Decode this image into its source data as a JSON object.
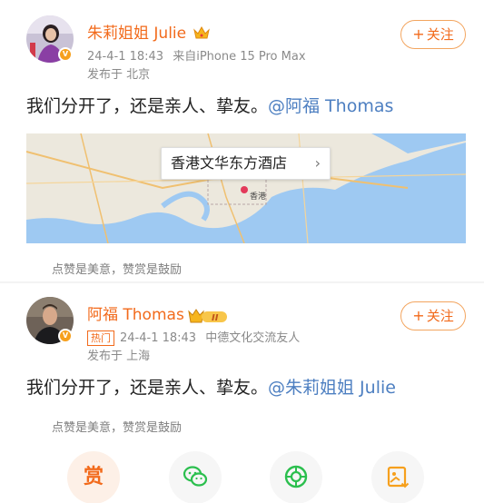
{
  "post1": {
    "username": "朱莉姐姐 Julie",
    "time": "24-4-1 18:43",
    "source": "来自iPhone 15 Pro Max",
    "location": "发布于 北京",
    "follow_label": "关注",
    "content_text": "我们分开了，还是亲人、挚友。",
    "mention": "@阿福 Thomas",
    "map_place": "香港文华东方酒店",
    "map_tag": "香港",
    "like_hint": "点赞是美意，赞赏是鼓励"
  },
  "post2": {
    "username": "阿福 Thomas",
    "badge_level": "II",
    "hot_label": "热门",
    "time": "24-4-1 18:43",
    "source": "中德文化交流友人",
    "location": "发布于 上海",
    "follow_label": "关注",
    "content_text": "我们分开了，还是亲人、挚友。",
    "mention": "@朱莉姐姐 Julie",
    "like_hint": "点赞是美意，赞赏是鼓励"
  },
  "actions": {
    "reward_label": "赏"
  },
  "colors": {
    "accent": "#f26a1b",
    "mention": "#4d7fc1",
    "sea": "#9ec9f2"
  },
  "icons": [
    "verified-badge-icon",
    "crown-icon",
    "plus-icon",
    "chevron-right-icon",
    "wechat-icon",
    "moments-icon",
    "save-image-icon"
  ]
}
